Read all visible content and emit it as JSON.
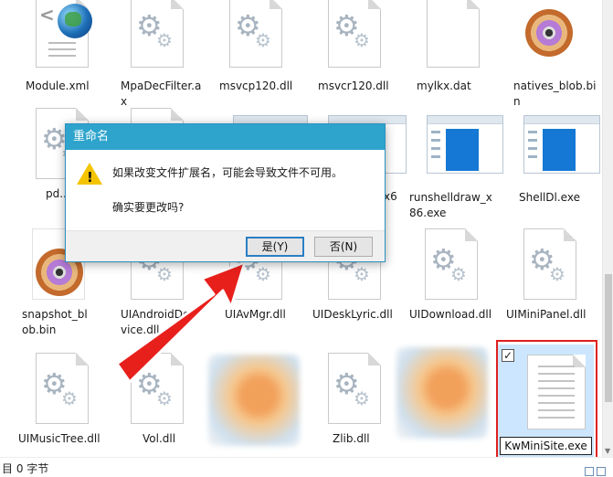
{
  "files": [
    {
      "name": "Module.xml",
      "icon": "xml-globe-icon"
    },
    {
      "name": "MpaDecFilter.ax",
      "icon": "gear-doc-icon"
    },
    {
      "name": "msvcp120.dll",
      "icon": "gear-doc-icon"
    },
    {
      "name": "msvcr120.dll",
      "icon": "gear-doc-icon"
    },
    {
      "name": "mylkx.dat",
      "icon": "blank-doc-icon"
    },
    {
      "name": "natives_blob.bin",
      "icon": "disc-icon"
    },
    {
      "name": "pd...",
      "icon": "gear-doc-icon"
    },
    {
      "name": "x6",
      "icon": "window-icon"
    },
    {
      "name": "runshelldraw_x86.exe",
      "icon": "window-icon"
    },
    {
      "name": "ShellDl.exe",
      "icon": "window-icon"
    },
    {
      "name": "snapshot_blob.bin",
      "icon": "disc-icon"
    },
    {
      "name": "UIAndroidDevice.dll",
      "icon": "gear-doc-icon"
    },
    {
      "name": "UIAvMgr.dll",
      "icon": "gear-doc-icon"
    },
    {
      "name": "UIDeskLyric.dll",
      "icon": "gear-doc-icon"
    },
    {
      "name": "UIDownload.dll",
      "icon": "gear-doc-icon"
    },
    {
      "name": "UIMiniPanel.dll",
      "icon": "gear-doc-icon"
    },
    {
      "name": "UIMusicTree.dll",
      "icon": "gear-doc-icon"
    },
    {
      "name": "Vol.dll",
      "icon": "gear-doc-icon"
    },
    {
      "name": "Zlib.dll",
      "icon": "gear-doc-icon"
    },
    {
      "name": "KwMiniSite.exe",
      "icon": "text-doc-icon"
    }
  ],
  "rename_value": "KwMiniSite.exe",
  "checkbox_mark": "✓",
  "status": {
    "text": "目 0 字节"
  },
  "dialog": {
    "title": "重命名",
    "message": "如果改变文件扩展名，可能会导致文件不可用。",
    "question": "确实要更改吗?",
    "yes_label": "是(Y)",
    "no_label": "否(N)"
  },
  "colors": {
    "accent": "#2ea4cc",
    "selection": "#cce6ff",
    "highlight": "#e02020",
    "arrow": "#e8201c"
  }
}
